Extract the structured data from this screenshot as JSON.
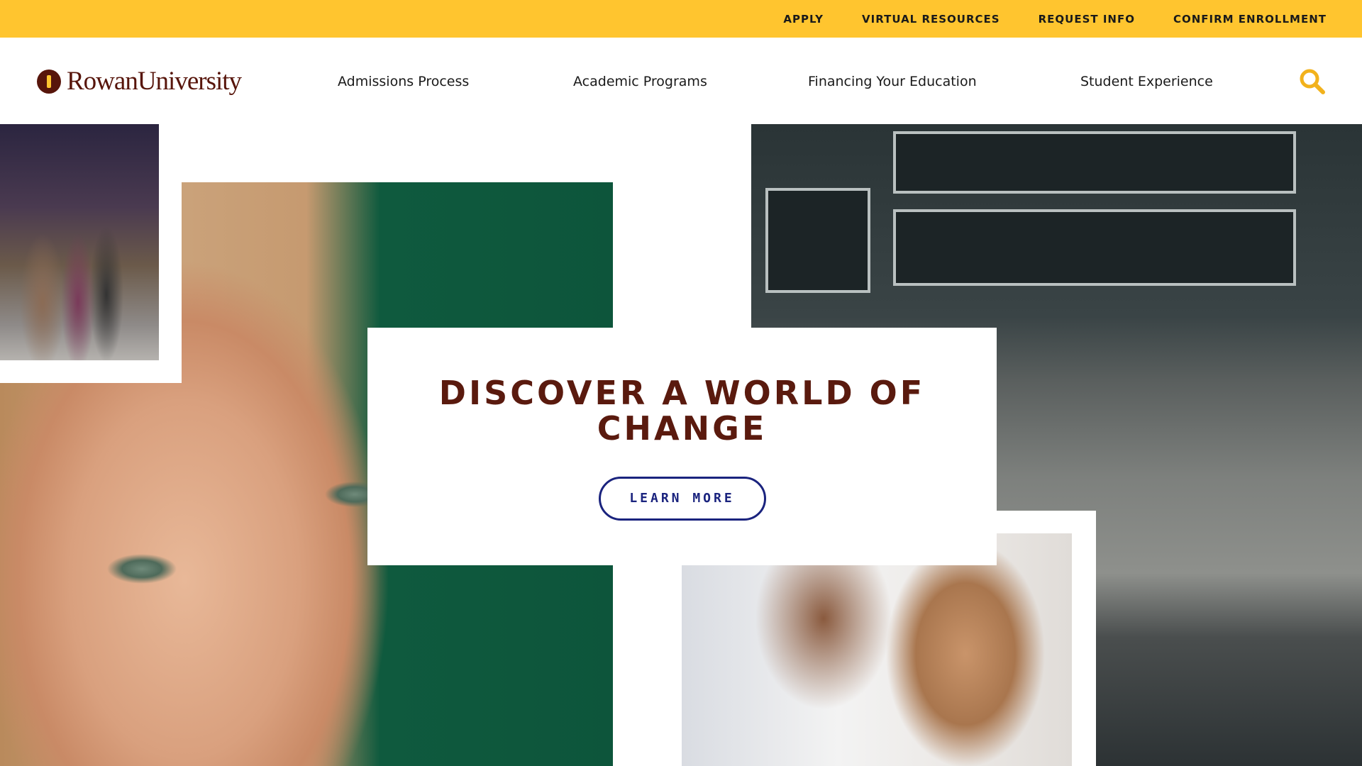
{
  "utility_nav": {
    "items": [
      "APPLY",
      "VIRTUAL RESOURCES",
      "REQUEST INFO",
      "CONFIRM ENROLLMENT"
    ]
  },
  "header": {
    "logo_text": "RowanUniversity",
    "nav": [
      "Admissions Process",
      "Academic Programs",
      "Financing Your Education",
      "Student Experience"
    ],
    "search_icon": "search-icon"
  },
  "hero": {
    "title": "DISCOVER A WORLD OF CHANGE",
    "button_label": "LEARN MORE"
  },
  "colors": {
    "utility_bar": "#FFC52F",
    "brand_brown": "#57150B",
    "button_navy": "#1A237E",
    "search_gold": "#F2B21C"
  },
  "images": [
    "students-walking-street-photo",
    "student-portrait-photo",
    "campus-steps-photo",
    "lab-researchers-photo"
  ]
}
